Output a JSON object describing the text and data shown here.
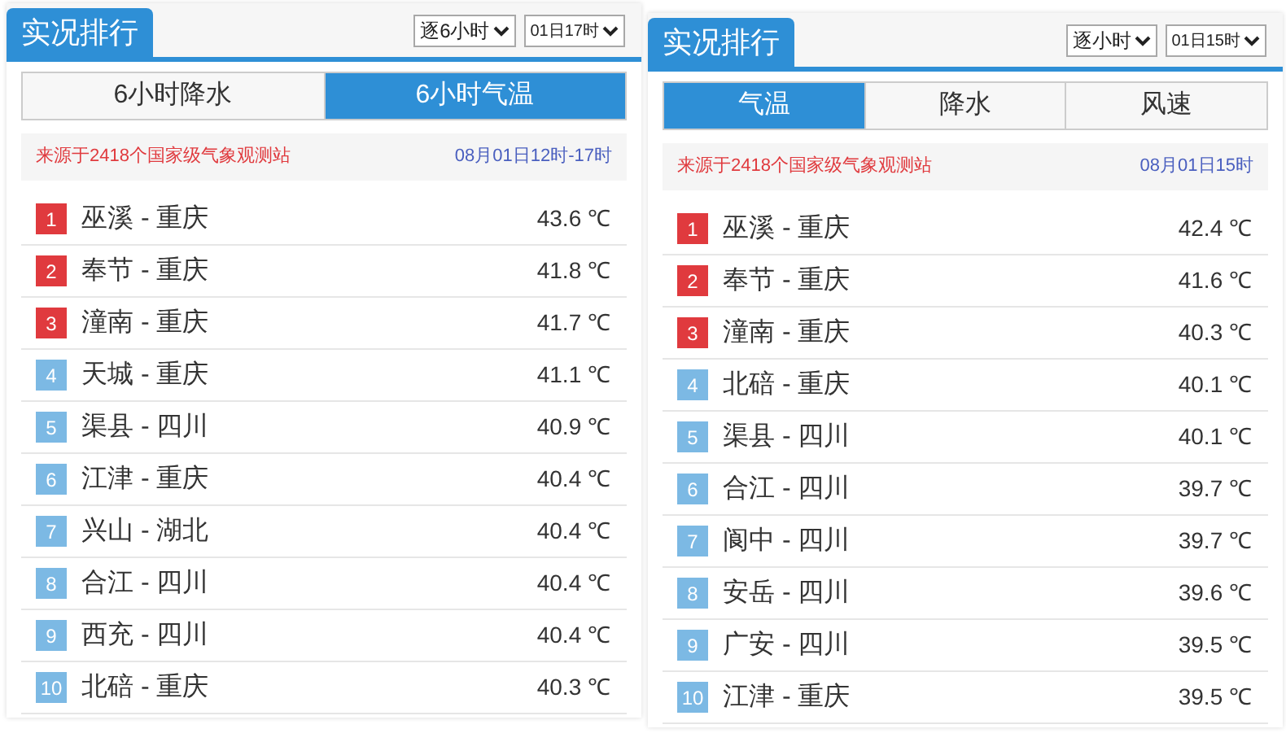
{
  "panels": [
    {
      "title": "实况排行",
      "selects": [
        {
          "value": "逐6小时"
        },
        {
          "value": "01日17时"
        }
      ],
      "tabs": [
        {
          "label": "6小时降水",
          "selected": false
        },
        {
          "label": "6小时气温",
          "selected": true
        }
      ],
      "source": "来源于2418个国家级气象观测站",
      "time": "08月01日12时-17时",
      "rows": [
        {
          "rank": "1",
          "color": "#e03a3e",
          "name": "巫溪 - 重庆",
          "value": "43.6 ℃"
        },
        {
          "rank": "2",
          "color": "#e03a3e",
          "name": "奉节 - 重庆",
          "value": "41.8 ℃"
        },
        {
          "rank": "3",
          "color": "#e03a3e",
          "name": "潼南 - 重庆",
          "value": "41.7 ℃"
        },
        {
          "rank": "4",
          "color": "#7cb9e4",
          "name": "天城 - 重庆",
          "value": "41.1 ℃"
        },
        {
          "rank": "5",
          "color": "#7cb9e4",
          "name": "渠县 - 四川",
          "value": "40.9 ℃"
        },
        {
          "rank": "6",
          "color": "#7cb9e4",
          "name": "江津 - 重庆",
          "value": "40.4 ℃"
        },
        {
          "rank": "7",
          "color": "#7cb9e4",
          "name": "兴山 - 湖北",
          "value": "40.4 ℃"
        },
        {
          "rank": "8",
          "color": "#7cb9e4",
          "name": "合江 - 四川",
          "value": "40.4 ℃"
        },
        {
          "rank": "9",
          "color": "#7cb9e4",
          "name": "西充 - 四川",
          "value": "40.4 ℃"
        },
        {
          "rank": "10",
          "color": "#7cb9e4",
          "name": "北碚 - 重庆",
          "value": "40.3 ℃"
        }
      ]
    },
    {
      "title": "实况排行",
      "selects": [
        {
          "value": "逐小时"
        },
        {
          "value": "01日15时"
        }
      ],
      "tabs": [
        {
          "label": "气温",
          "selected": true
        },
        {
          "label": "降水",
          "selected": false
        },
        {
          "label": "风速",
          "selected": false
        }
      ],
      "source": "来源于2418个国家级气象观测站",
      "time": "08月01日15时",
      "rows": [
        {
          "rank": "1",
          "color": "#e03a3e",
          "name": "巫溪 - 重庆",
          "value": "42.4 ℃"
        },
        {
          "rank": "2",
          "color": "#e03a3e",
          "name": "奉节 - 重庆",
          "value": "41.6 ℃"
        },
        {
          "rank": "3",
          "color": "#e03a3e",
          "name": "潼南 - 重庆",
          "value": "40.3 ℃"
        },
        {
          "rank": "4",
          "color": "#7cb9e4",
          "name": "北碚 - 重庆",
          "value": "40.1 ℃"
        },
        {
          "rank": "5",
          "color": "#7cb9e4",
          "name": "渠县 - 四川",
          "value": "40.1 ℃"
        },
        {
          "rank": "6",
          "color": "#7cb9e4",
          "name": "合江 - 四川",
          "value": "39.7 ℃"
        },
        {
          "rank": "7",
          "color": "#7cb9e4",
          "name": "阆中 - 四川",
          "value": "39.7 ℃"
        },
        {
          "rank": "8",
          "color": "#7cb9e4",
          "name": "安岳 - 四川",
          "value": "39.6 ℃"
        },
        {
          "rank": "9",
          "color": "#7cb9e4",
          "name": "广安 - 四川",
          "value": "39.5 ℃"
        },
        {
          "rank": "10",
          "color": "#7cb9e4",
          "name": "江津 - 重庆",
          "value": "39.5 ℃"
        }
      ]
    }
  ]
}
